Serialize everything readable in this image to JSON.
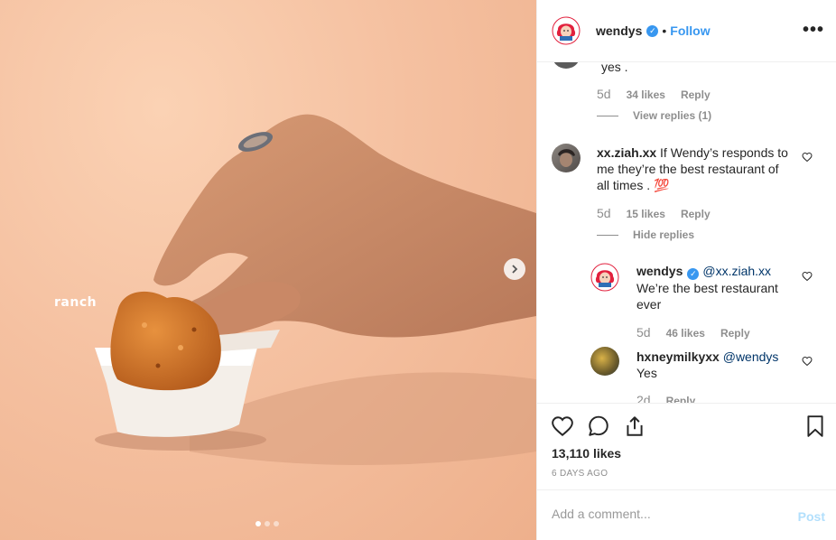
{
  "photo": {
    "caption": "ranch",
    "carousel_total": 3,
    "carousel_active": 1
  },
  "account": {
    "username": "wendys",
    "verified_badge": "✓",
    "separator": "•",
    "follow_label": "Follow",
    "more_label": "•••"
  },
  "comments": {
    "partial": {
      "text": "yes .",
      "time": "5d",
      "likes": "34 likes",
      "reply": "Reply",
      "view_replies": "View replies (1)"
    },
    "c1": {
      "username": "xx.ziah.xx",
      "text": "If Wendy’s responds to me they’re the best restaurant of all times .",
      "emoji": "💯",
      "time": "5d",
      "likes": "15 likes",
      "reply": "Reply",
      "hide_replies": "Hide replies"
    },
    "r1": {
      "username": "wendys",
      "mention": "@xx.ziah.xx",
      "text": "We’re the best restaurant ever",
      "time": "5d",
      "likes": "46 likes",
      "reply": "Reply"
    },
    "r2": {
      "username": "hxneymilkyxx",
      "mention": "@wendys",
      "text": "Yes",
      "time": "2d",
      "reply": "Reply"
    }
  },
  "footer": {
    "likes_count": "13,110 likes",
    "timestamp": "6 DAYS AGO",
    "comment_placeholder": "Add a comment...",
    "post_label": "Post"
  },
  "colors": {
    "accent": "#3897f0",
    "mention": "#003569",
    "muted": "#8e8e8e",
    "post_disabled": "#b2dffc",
    "wendys_red": "#e2203d"
  },
  "icons": [
    "chevron-right-icon",
    "heart-icon",
    "comment-icon",
    "share-icon",
    "bookmark-icon",
    "more-icon",
    "verified-icon"
  ]
}
